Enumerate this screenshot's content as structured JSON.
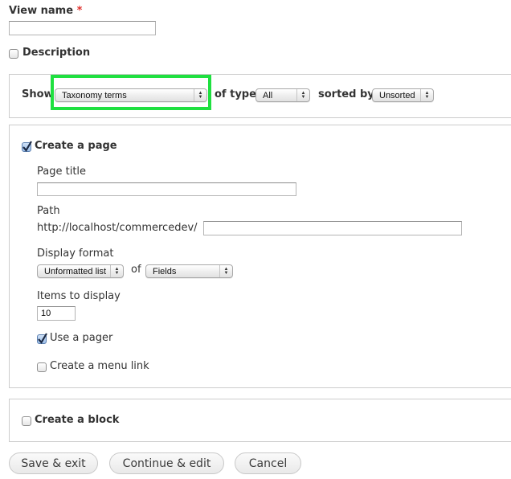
{
  "view_name": {
    "label": "View name",
    "required_marker": "*",
    "value": ""
  },
  "description": {
    "label": "Description",
    "checked": false
  },
  "show_row": {
    "show_label": "Show",
    "show_value": "Taxonomy terms",
    "of_type_label": "of type",
    "of_type_value": "All",
    "sorted_by_label": "sorted by",
    "sorted_by_value": "Unsorted",
    "highlight_color": "#1fe040"
  },
  "page_section": {
    "create_page_label": "Create a page",
    "create_page_checked": true,
    "page_title_label": "Page title",
    "page_title_value": "",
    "path_label": "Path",
    "path_prefix": "http://localhost/commercedev/",
    "path_value": "",
    "display_format_label": "Display format",
    "display_format_value": "Unformatted list",
    "of_label": "of",
    "of_value": "Fields",
    "items_to_display_label": "Items to display",
    "items_to_display_value": "10",
    "use_pager_label": "Use a pager",
    "use_pager_checked": true,
    "menu_link_label": "Create a menu link",
    "menu_link_checked": false
  },
  "block_section": {
    "create_block_label": "Create a block",
    "create_block_checked": false
  },
  "actions": {
    "save_exit": "Save & exit",
    "continue_edit": "Continue & edit",
    "cancel": "Cancel"
  },
  "icons": {
    "select_arrows": "▲▼",
    "checkmark": "check-icon"
  }
}
